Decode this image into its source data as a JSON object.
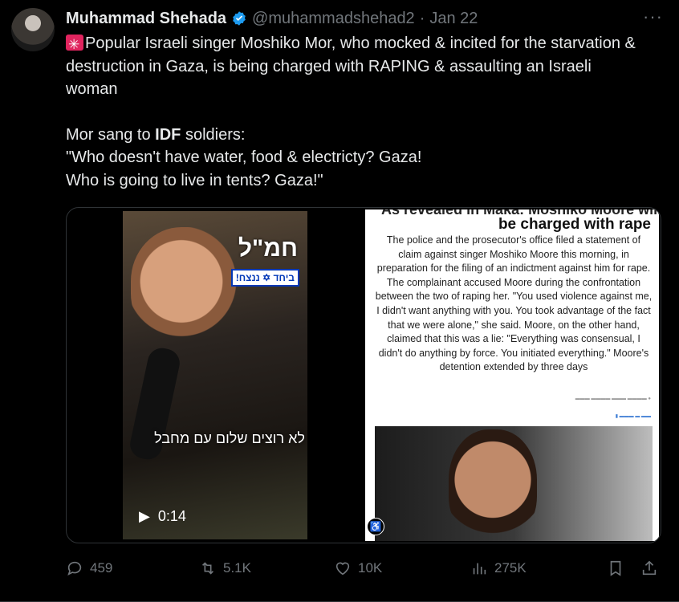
{
  "header": {
    "name": "Muhammad Shehada",
    "handle": "@muhammadshehad2",
    "dot": "·",
    "date": "Jan 22",
    "more": "···"
  },
  "tweet": {
    "line1": "Popular Israeli singer Moshiko Mor, who mocked & incited for the starvation & destruction in Gaza, is being charged with RAPING & assaulting an Israeli woman",
    "line2_prefix": "Mor sang to ",
    "line2_bold": "IDF",
    "line2_suffix": " soldiers:",
    "line3": "\"Who doesn't have water, food & electricty? Gaza!",
    "line4": "Who is going to live in tents? Gaza!\""
  },
  "video": {
    "overlay_top": "חמ\"ל",
    "flag_tag": "ביחד ✡ ננצח!",
    "caption": "לא רוצים שלום עם מחבל",
    "duration": "0:14"
  },
  "article": {
    "cut_headline": "As revealed in Maka: Moshiko Moore will",
    "headline": "be charged with rape",
    "body": "The police and the prosecutor's office filed a statement of claim against singer Moshiko Moore this morning, in preparation for the filing of an indictment against him for rape. The complainant accused Moore during the confrontation between the two of raping her. \"You used violence against me, I didn't want anything with you. You took advantage of the fact that we were alone,\" she said. Moore, on the other hand, claimed that this was a lie: \"Everything was consensual, I didn't do anything by force. You initiated everything.\" Moore's detention extended by three days"
  },
  "actions": {
    "replies": "459",
    "reposts": "5.1K",
    "likes": "10K",
    "views": "275K"
  },
  "colors": {
    "background": "#000000",
    "text": "#e7e9ea",
    "muted": "#71767b",
    "verified": "#1d9bf0"
  }
}
